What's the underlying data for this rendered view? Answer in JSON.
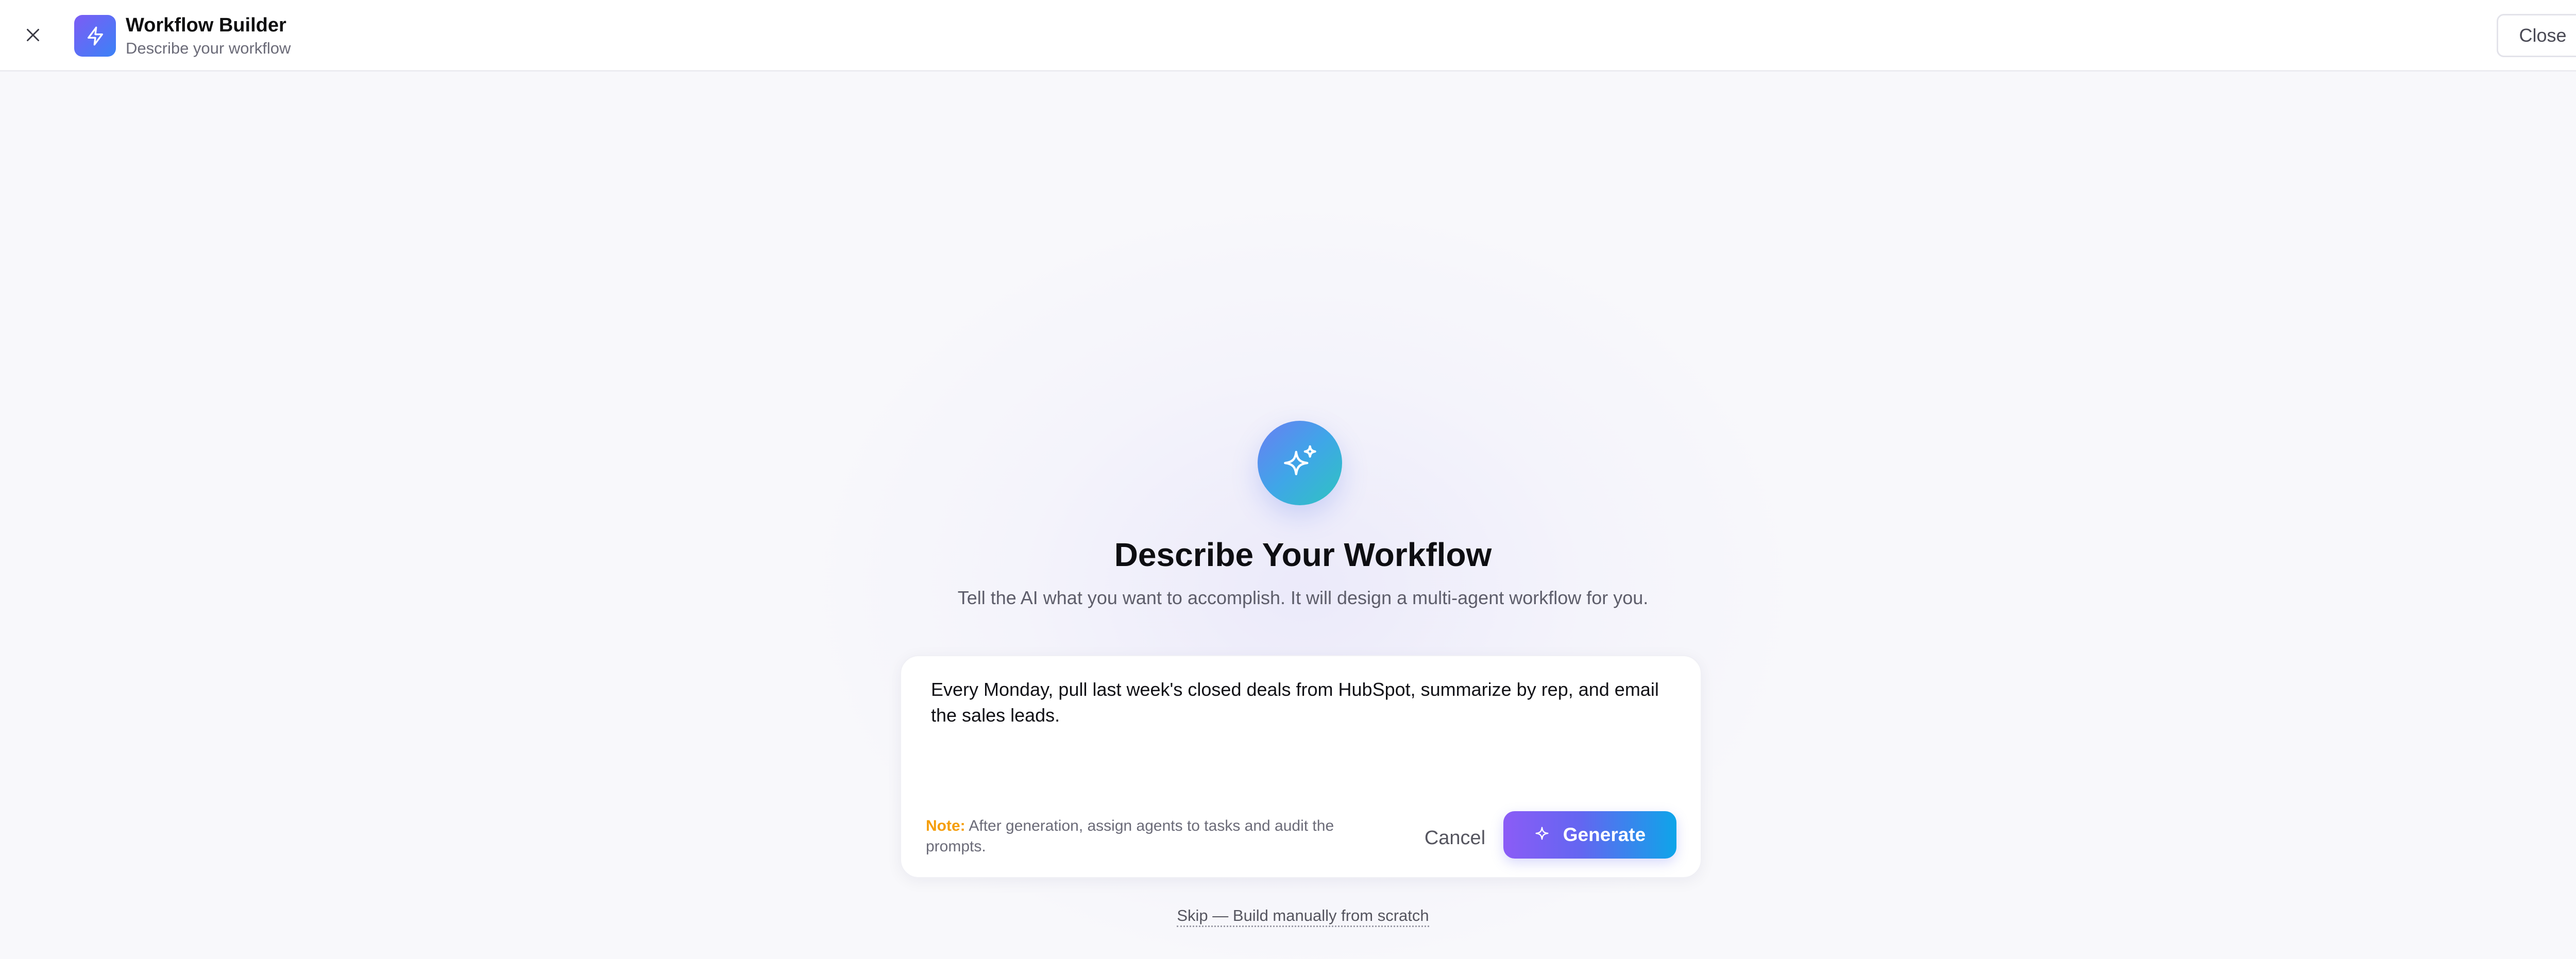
{
  "header": {
    "title": "Workflow Builder",
    "subtitle": "Describe your workflow",
    "close_label": "Close",
    "app_icon": "lightning-icon",
    "dismiss_icon": "close-icon"
  },
  "hero": {
    "icon": "sparkles-icon",
    "heading": "Describe Your Workflow",
    "description": "Tell the AI what you want to accomplish. It will design a multi-agent workflow for you."
  },
  "prompt_card": {
    "prompt_value": "Every Monday, pull last week's closed deals from HubSpot, summarize by rep, and email the sales leads.",
    "note_label": "Note:",
    "note_text": "After generation, assign agents to tasks and audit the prompts.",
    "cancel_label": "Cancel",
    "generate_label": "Generate",
    "generate_icon": "sparkle-icon"
  },
  "skip_link": "Skip — Build manually from scratch",
  "colors": {
    "accent_gradient_start": "#8b5cf6",
    "accent_gradient_end": "#0ea5e9",
    "note_label": "#f59e0b",
    "background": "#f8f8fb"
  }
}
